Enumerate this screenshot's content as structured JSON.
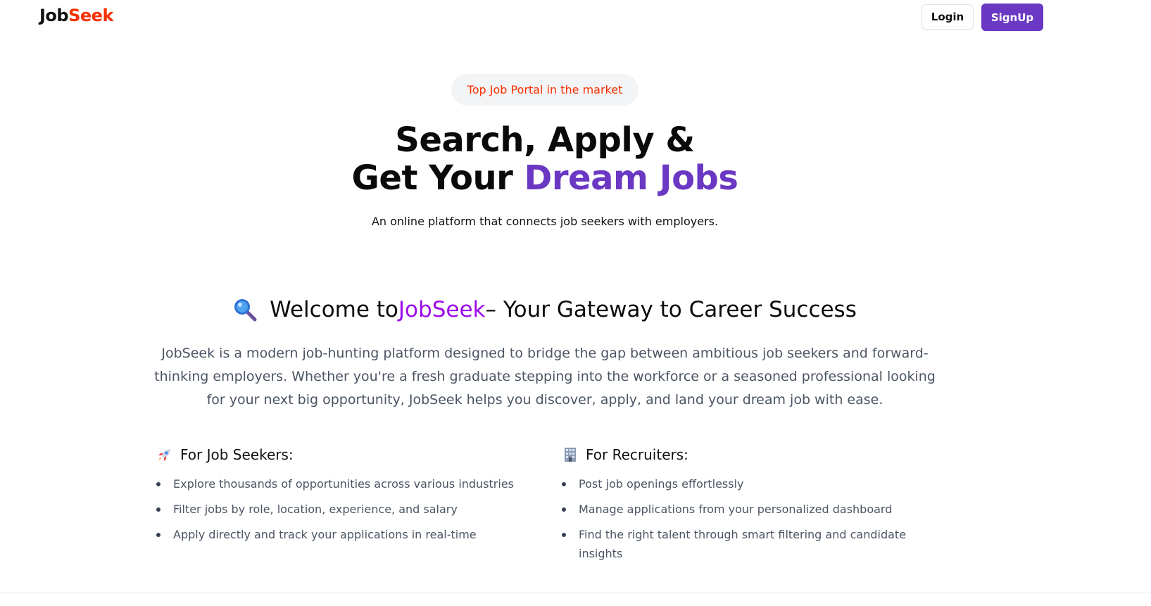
{
  "nav": {
    "logo_part1": "Job",
    "logo_part2": "Seek",
    "login_label": "Login",
    "signup_label": "SignUp"
  },
  "hero": {
    "badge": "Top Job Portal in the market",
    "title_line1": "Search, Apply &",
    "title_line2_prefix": "Get Your ",
    "title_line2_accent": "Dream Jobs",
    "subtitle": "An online platform that connects job seekers with employers."
  },
  "welcome": {
    "prefix": "Welcome to ",
    "brand": "JobSeek",
    "suffix": " – Your Gateway to Career Success",
    "description": "JobSeek is a modern job-hunting platform designed to bridge the gap between ambitious job seekers and forward-thinking employers. Whether you're a fresh graduate stepping into the workforce or a seasoned professional looking for your next big opportunity, JobSeek helps you discover, apply, and land your dream job with ease."
  },
  "seekers": {
    "title": "For Job Seekers:",
    "items": [
      "Explore thousands of opportunities across various industries",
      "Filter jobs by role, location, experience, and salary",
      "Apply directly and track your applications in real-time"
    ]
  },
  "recruiters": {
    "title": "For Recruiters:",
    "items": [
      "Post job openings effortlessly",
      "Manage applications from your personalized dashboard",
      "Find the right talent through smart filtering and candidate insights"
    ]
  },
  "colors": {
    "brand_red": "#f83002",
    "brand_purple": "#6a38c2",
    "welcome_brand": "#9b0bea"
  },
  "icons": {
    "welcome": "magnifying-glass-icon",
    "seekers": "rocket-icon",
    "recruiters": "office-building-icon"
  }
}
